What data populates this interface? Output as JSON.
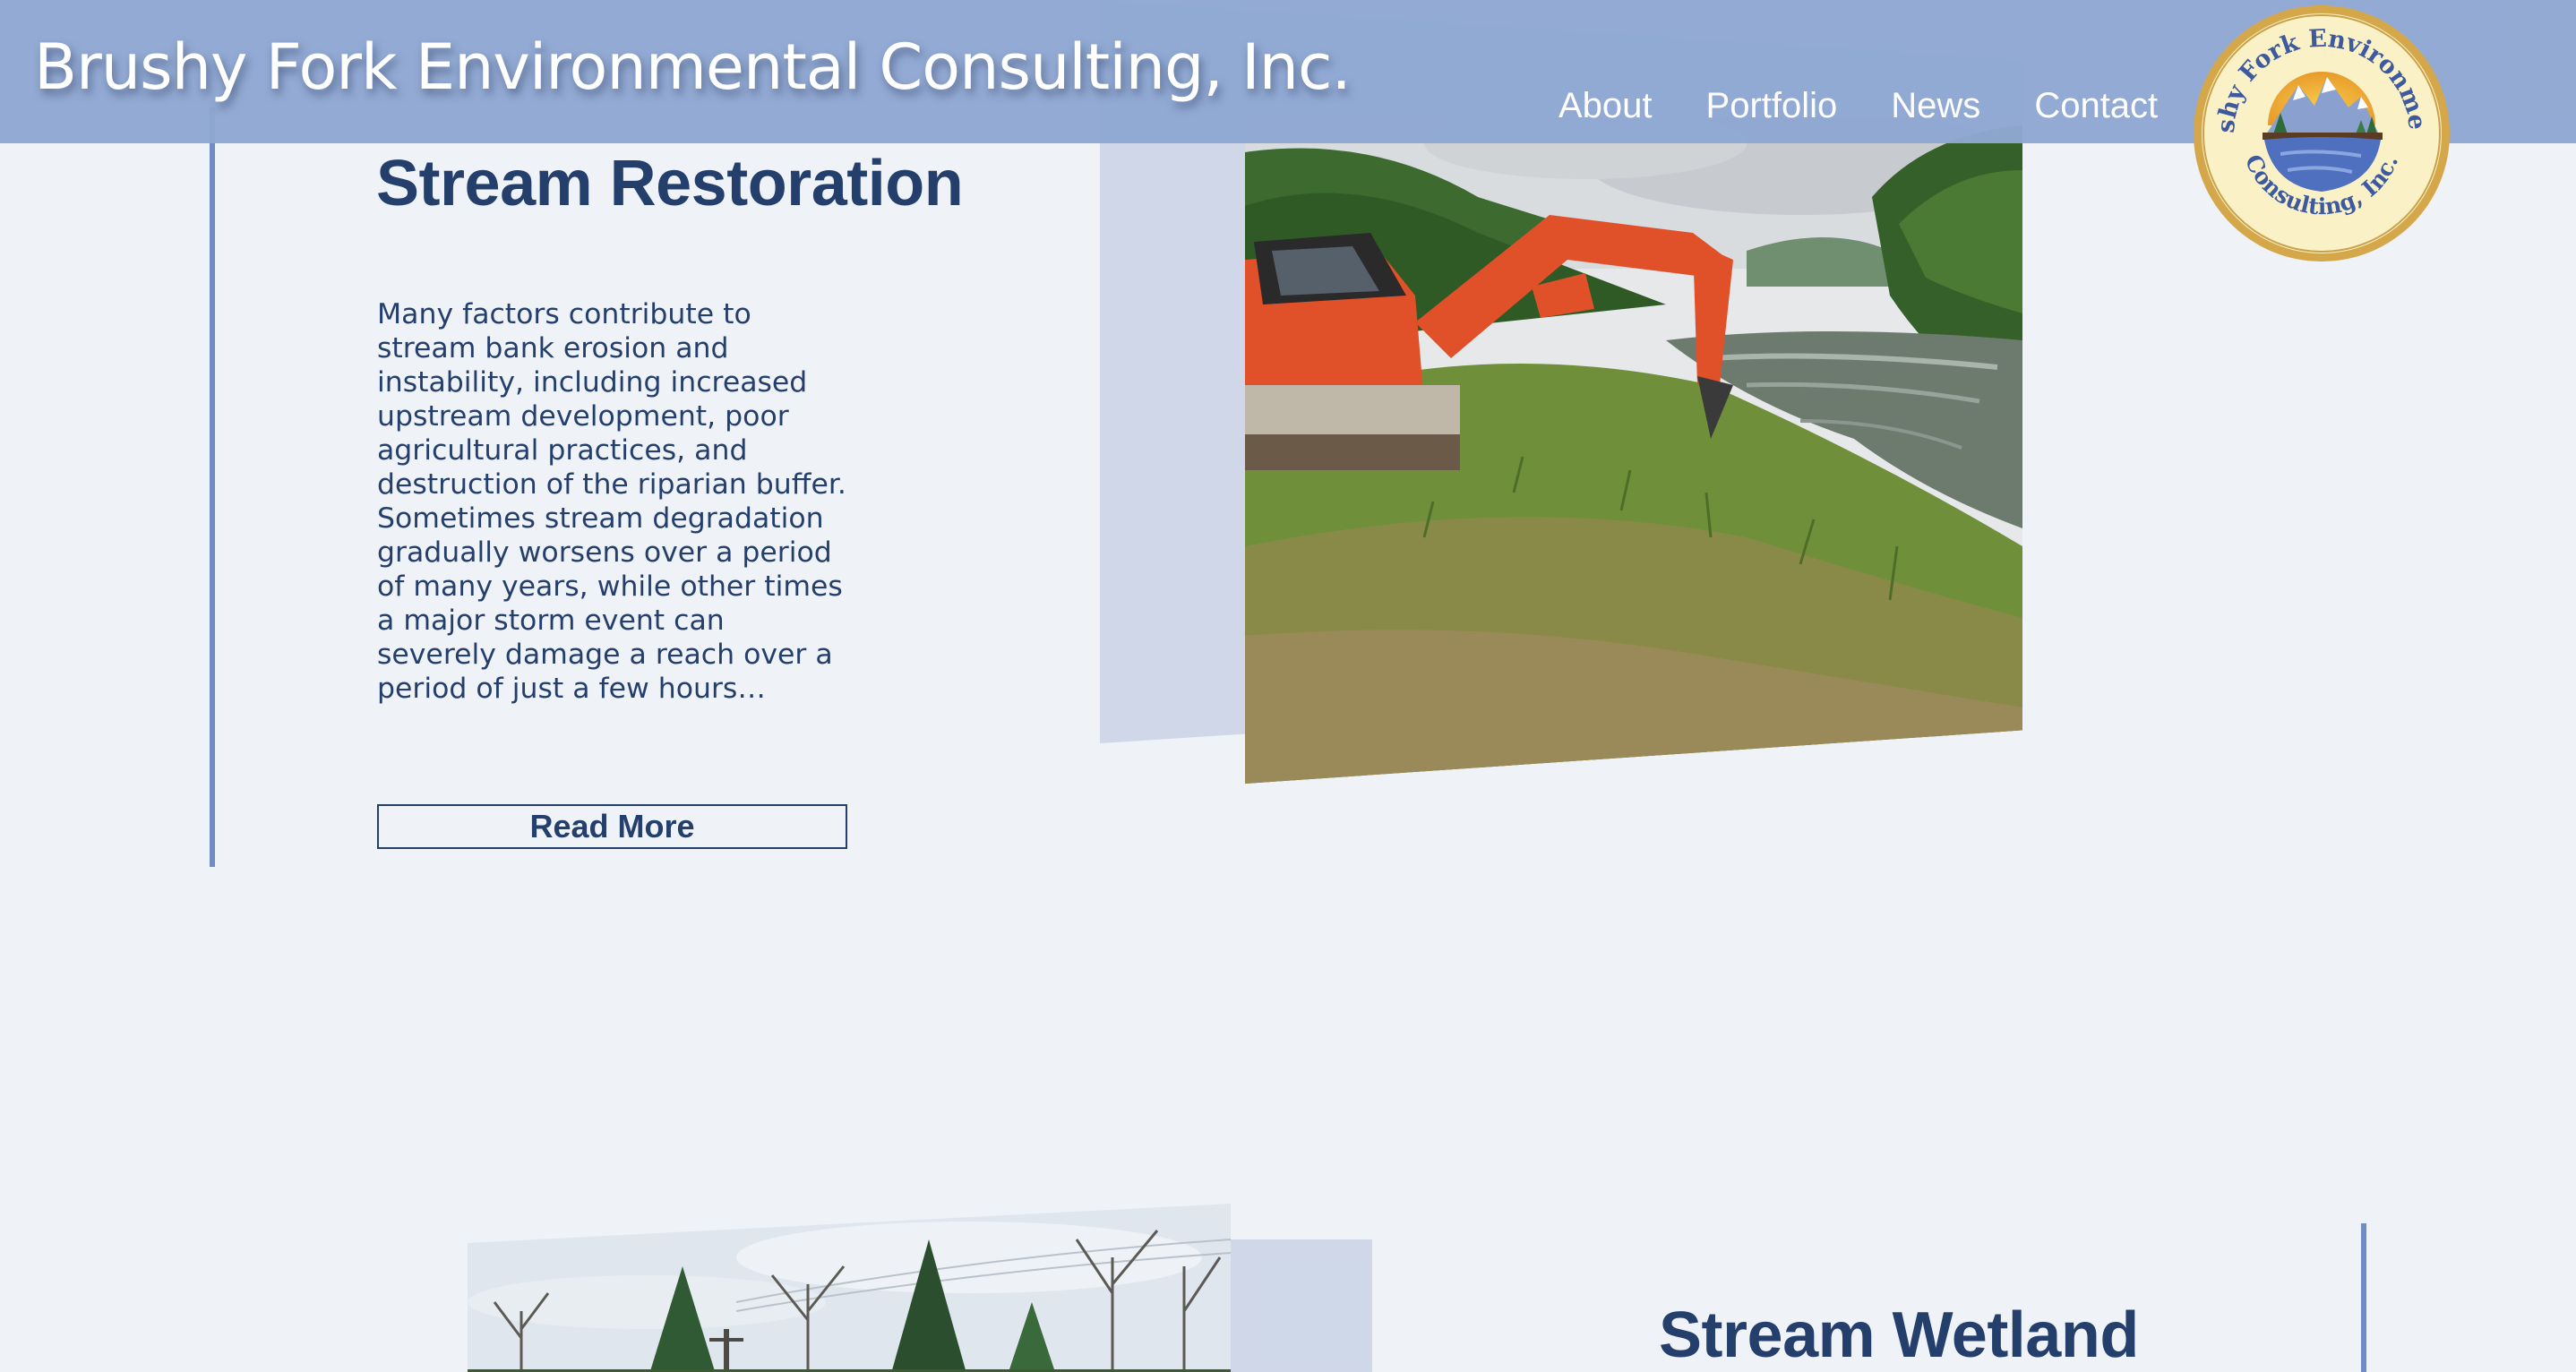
{
  "header": {
    "site_title": "Brushy Fork Environmental Consulting, Inc.",
    "nav": [
      {
        "label": "About"
      },
      {
        "label": "Portfolio"
      },
      {
        "label": "News"
      },
      {
        "label": "Contact"
      }
    ],
    "logo_text_top": "Brushy Fork Environmental",
    "logo_text_bottom": "Consulting, Inc."
  },
  "sections": [
    {
      "title": "Stream Restoration",
      "body": "Many factors contribute to stream bank erosion and instability, including increased upstream development, poor agricultural practices, and destruction of the riparian buffer. Sometimes stream degradation gradually worsens over a period of many years, while other times a major storm event can severely damage a reach over a period of just a few hours…",
      "button_label": "Read More",
      "photo_icon": "excavator-riverbank-photo"
    },
    {
      "title": "Stream Wetland",
      "photo_icon": "trees-sky-photo"
    }
  ],
  "colors": {
    "header_bg": "#8fa8d2",
    "page_bg": "#eff2f7",
    "heading": "#243f6c",
    "accent_line": "#6f8cc5",
    "logo_ring": "#d9b04a"
  }
}
